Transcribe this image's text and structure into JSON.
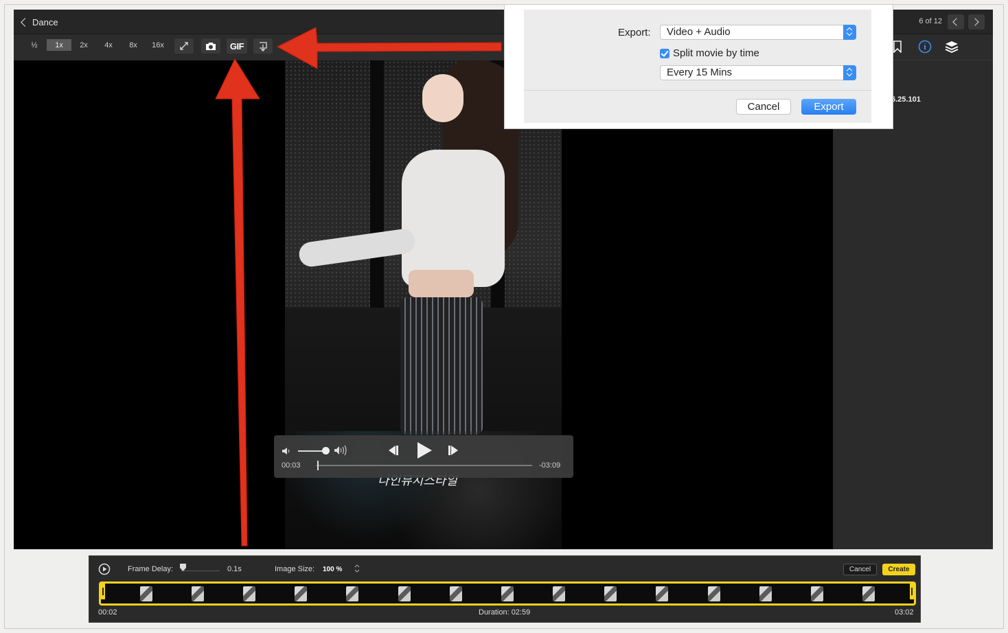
{
  "window": {
    "back_label": "Dance",
    "page_counter": "6 of 12"
  },
  "toolbar": {
    "speeds": [
      "½",
      "1x",
      "2x",
      "4x",
      "8x",
      "16x"
    ],
    "active_speed": "1x",
    "gif_label": "GIF",
    "icons": [
      "fullscreen-icon",
      "camera-icon",
      "gif-icon",
      "export-icon"
    ]
  },
  "sidebar": {
    "icons": [
      "bookmark-icon",
      "info-icon",
      "layers-icon"
    ],
    "ip_fragment": "6.25.101"
  },
  "video": {
    "watermark": "나인뮤지스타일"
  },
  "player": {
    "elapsed": "00:03",
    "remaining": "-03:09",
    "icons": [
      "volume-low-icon",
      "volume-high-icon",
      "step-back-icon",
      "play-icon",
      "step-forward-icon"
    ]
  },
  "export_dialog": {
    "export_label": "Export:",
    "export_value": "Video + Audio",
    "split_label": "Split movie by time",
    "split_checked": true,
    "interval_value": "Every 15 Mins",
    "cancel_label": "Cancel",
    "export_button": "Export",
    "accent": "#3a8ef2"
  },
  "gif_panel": {
    "frame_delay_label": "Frame Delay:",
    "frame_delay_value": "0.1s",
    "image_size_label": "Image Size:",
    "image_size_value": "100 %",
    "cancel_label": "Cancel",
    "create_label": "Create",
    "start_time": "00:02",
    "duration": "Duration: 02:59",
    "end_time": "03:02",
    "thumbnail_count": 15,
    "accent": "#f3d31b"
  },
  "annotations": {
    "arrow_color": "#e0321c"
  }
}
